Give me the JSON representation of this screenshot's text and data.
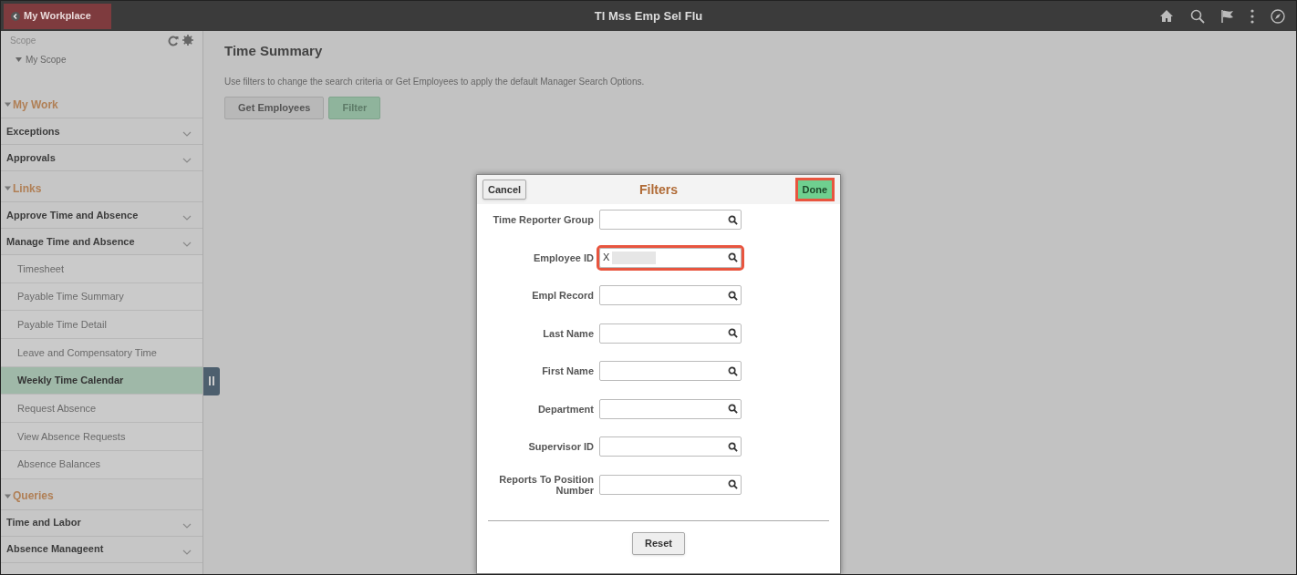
{
  "header": {
    "back_button": "My Workplace",
    "title": "Tl Mss Emp Sel Flu"
  },
  "sidebar": {
    "scope_label": "Scope",
    "scope_item": "My Scope",
    "sections": [
      {
        "title": "My Work",
        "expanded": true,
        "items": [
          {
            "label": "Exceptions",
            "kind": "group",
            "selected": false
          },
          {
            "label": "Approvals",
            "kind": "group",
            "selected": false
          }
        ]
      },
      {
        "title": "Links",
        "expanded": true,
        "items": [
          {
            "label": "Approve Time and Absence",
            "kind": "group",
            "selected": false
          },
          {
            "label": "Manage Time and Absence",
            "kind": "group",
            "selected": false
          },
          {
            "label": "Timesheet",
            "kind": "link",
            "selected": false
          },
          {
            "label": "Payable Time Summary",
            "kind": "link",
            "selected": false
          },
          {
            "label": "Payable Time Detail",
            "kind": "link",
            "selected": false
          },
          {
            "label": "Leave and Compensatory Time",
            "kind": "link",
            "selected": false
          },
          {
            "label": "Weekly Time Calendar",
            "kind": "link",
            "selected": true
          },
          {
            "label": "Request Absence",
            "kind": "link",
            "selected": false
          },
          {
            "label": "View Absence Requests",
            "kind": "link",
            "selected": false
          },
          {
            "label": "Absence Balances",
            "kind": "link",
            "selected": false
          }
        ]
      },
      {
        "title": "Queries",
        "expanded": true,
        "items": [
          {
            "label": "Time and Labor",
            "kind": "group",
            "selected": false
          },
          {
            "label": "Absence Manageent",
            "kind": "group",
            "selected": false
          }
        ]
      }
    ]
  },
  "main": {
    "title": "Time Summary",
    "instructions": "Use filters to change the search criteria or Get Employees to apply the default Manager Search Options.",
    "buttons": [
      {
        "label": "Get Employees",
        "selected": false
      },
      {
        "label": "Filter",
        "selected": true
      }
    ]
  },
  "dialog": {
    "title": "Filters",
    "cancel": "Cancel",
    "done": {
      "label": "Done",
      "highlighted": true
    },
    "fields": [
      {
        "label": "Time Reporter Group",
        "highlighted": false
      },
      {
        "label": "Employee ID",
        "value": "X",
        "redacted": true,
        "highlighted": true
      },
      {
        "label": "Empl Record",
        "highlighted": false
      },
      {
        "label": "Last Name",
        "highlighted": false
      },
      {
        "label": "First Name",
        "highlighted": false
      },
      {
        "label": "Department",
        "highlighted": false
      },
      {
        "label": "Supervisor ID",
        "highlighted": false
      },
      {
        "label": "Reports To Position Number",
        "highlighted": false
      }
    ],
    "reset": "Reset"
  }
}
